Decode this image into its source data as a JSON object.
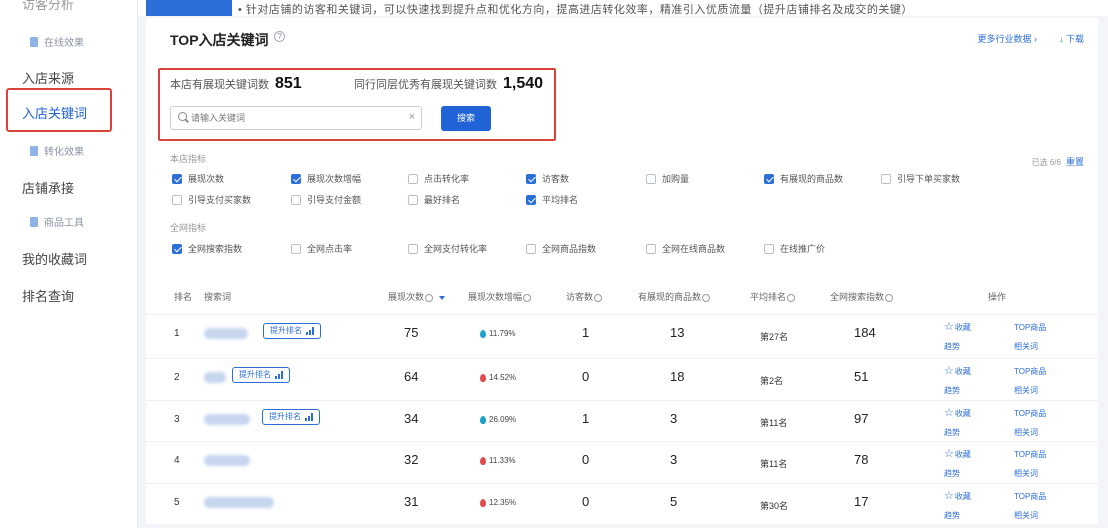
{
  "sidebar": {
    "top_cut": "访客分析",
    "items": [
      {
        "label": "在线效果",
        "kind": "sub"
      },
      {
        "label": "入店来源",
        "kind": "main"
      },
      {
        "label": "入店关键词",
        "kind": "active"
      },
      {
        "label": "转化效果",
        "kind": "sub"
      },
      {
        "label": "店铺承接",
        "kind": "main"
      },
      {
        "label": "商品工具",
        "kind": "sub"
      },
      {
        "label": "我的收藏词",
        "kind": "main"
      },
      {
        "label": "排名查询",
        "kind": "main"
      }
    ]
  },
  "topbar": {
    "note": "• 针对店铺的访客和关键词，可以快速找到提升点和优化方向，提高进店转化效率，精准引入优质流量（提升店铺排名及成交的关键）"
  },
  "card": {
    "title": "TOP入店关键词",
    "help": "?",
    "top_right": [
      "更多行业数据 ›",
      "↓ 下载"
    ]
  },
  "stats": {
    "shop_label": "本店有展现关键词数",
    "shop_value": "851",
    "industry_label": "同行同层优秀有展现关键词数",
    "industry_value": "1,540"
  },
  "search": {
    "placeholder": "请输入关键词",
    "clear": "×",
    "button": "搜索"
  },
  "filters": {
    "group1_label": "本店指标",
    "group2_label": "全网指标",
    "selected_count": "已选 6/6",
    "reset": "重置",
    "group1": [
      {
        "label": "展现次数",
        "checked": true
      },
      {
        "label": "展现次数增幅",
        "checked": true
      },
      {
        "label": "点击转化率",
        "checked": false
      },
      {
        "label": "访客数",
        "checked": true
      },
      {
        "label": "加购量",
        "checked": false
      },
      {
        "label": "有展现的商品数",
        "checked": true
      },
      {
        "label": "引导下单买家数",
        "checked": false
      },
      {
        "label": "引导支付买家数",
        "checked": false
      },
      {
        "label": "引导支付金额",
        "checked": false
      },
      {
        "label": "最好排名",
        "checked": false
      },
      {
        "label": "平均排名",
        "checked": true
      }
    ],
    "group2": [
      {
        "label": "全网搜索指数",
        "checked": true
      },
      {
        "label": "全网点击率",
        "checked": false
      },
      {
        "label": "全网支付转化率",
        "checked": false
      },
      {
        "label": "全网商品指数",
        "checked": false
      },
      {
        "label": "全网在线商品数",
        "checked": false
      },
      {
        "label": "在线推广价",
        "checked": false
      }
    ]
  },
  "table": {
    "headers": {
      "rank": "排名",
      "keyword": "搜索词",
      "impressions": "展现次数",
      "growth": "展现次数增幅",
      "visitors": "访客数",
      "products": "有展现的商品数",
      "avg_rank": "平均排名",
      "search_index": "全网搜索指数",
      "ops": "操作"
    },
    "tag_label": "提升排名",
    "rows": [
      {
        "rank": "1",
        "impressions": "75",
        "growth": "11.79%",
        "dir": "up",
        "visitors": "1",
        "products": "13",
        "avg_rank": "第27名",
        "search_index": "184"
      },
      {
        "rank": "2",
        "impressions": "64",
        "growth": "14.52%",
        "dir": "down",
        "visitors": "0",
        "products": "18",
        "avg_rank": "第2名",
        "search_index": "51"
      },
      {
        "rank": "3",
        "impressions": "34",
        "growth": "26.09%",
        "dir": "up",
        "visitors": "1",
        "products": "3",
        "avg_rank": "第11名",
        "search_index": "97"
      },
      {
        "rank": "4",
        "impressions": "32",
        "growth": "11.33%",
        "dir": "down",
        "visitors": "0",
        "products": "3",
        "avg_rank": "第11名",
        "search_index": "78"
      },
      {
        "rank": "5",
        "impressions": "31",
        "growth": "12.35%",
        "dir": "down",
        "visitors": "0",
        "products": "5",
        "avg_rank": "第30名",
        "search_index": "17"
      }
    ],
    "ops": {
      "favorite": "收藏",
      "top_product": "TOP商品",
      "trend": "趋势",
      "related": "相关词"
    }
  }
}
